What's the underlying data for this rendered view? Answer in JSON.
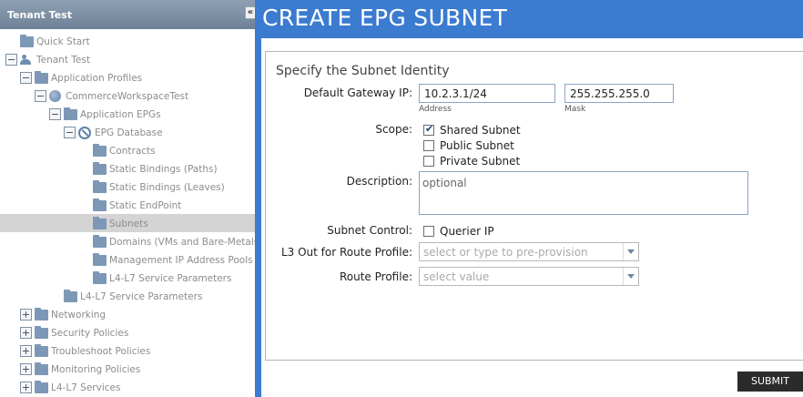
{
  "tree": {
    "title": "Tenant Test",
    "collapse_glyph": "«",
    "nodes": [
      {
        "label": "Quick Start",
        "expander": "none",
        "icon": "folder-icon",
        "indent": 0
      },
      {
        "label": "Tenant Test",
        "expander": "minus",
        "icon": "people-icon",
        "indent": 0
      },
      {
        "label": "Application Profiles",
        "expander": "minus",
        "icon": "folder-icon",
        "indent": 1
      },
      {
        "label": "CommerceWorkspaceTest",
        "expander": "minus",
        "icon": "profile-icon",
        "indent": 2
      },
      {
        "label": "Application EPGs",
        "expander": "minus",
        "icon": "folder-icon",
        "indent": 3
      },
      {
        "label": "EPG Database",
        "expander": "minus",
        "icon": "epg-icon",
        "indent": 4
      },
      {
        "label": "Contracts",
        "expander": "none",
        "icon": "folder-icon",
        "indent": 5
      },
      {
        "label": "Static Bindings (Paths)",
        "expander": "none",
        "icon": "folder-icon",
        "indent": 5
      },
      {
        "label": "Static Bindings (Leaves)",
        "expander": "none",
        "icon": "folder-icon",
        "indent": 5
      },
      {
        "label": "Static EndPoint",
        "expander": "none",
        "icon": "folder-icon",
        "indent": 5
      },
      {
        "label": "Subnets",
        "expander": "none",
        "icon": "folder-icon",
        "indent": 5,
        "selected": true
      },
      {
        "label": "Domains (VMs and Bare-Metals)",
        "expander": "none",
        "icon": "folder-icon",
        "indent": 5
      },
      {
        "label": "Management IP Address Pools",
        "expander": "none",
        "icon": "folder-icon",
        "indent": 5
      },
      {
        "label": "L4-L7 Service Parameters",
        "expander": "none",
        "icon": "folder-icon",
        "indent": 5
      },
      {
        "label": "L4-L7 Service Parameters",
        "expander": "none",
        "icon": "folder-icon",
        "indent": 3
      },
      {
        "label": "Networking",
        "expander": "plus",
        "icon": "folder-icon",
        "indent": 1
      },
      {
        "label": "Security Policies",
        "expander": "plus",
        "icon": "folder-icon",
        "indent": 1
      },
      {
        "label": "Troubleshoot Policies",
        "expander": "plus",
        "icon": "folder-icon",
        "indent": 1
      },
      {
        "label": "Monitoring Policies",
        "expander": "plus",
        "icon": "folder-icon",
        "indent": 1
      },
      {
        "label": "L4-L7 Services",
        "expander": "plus",
        "icon": "folder-icon",
        "indent": 1
      }
    ]
  },
  "dialog": {
    "title": "CREATE EPG SUBNET",
    "section_title": "Specify the Subnet Identity",
    "gateway": {
      "label": "Default Gateway IP:",
      "address_value": "10.2.3.1/24",
      "address_hint": "Address",
      "mask_value": "255.255.255.0",
      "mask_hint": "Mask"
    },
    "scope": {
      "label": "Scope:",
      "options": [
        {
          "label": "Shared Subnet",
          "checked": true
        },
        {
          "label": "Public Subnet",
          "checked": false
        },
        {
          "label": "Private Subnet",
          "checked": false
        }
      ]
    },
    "description": {
      "label": "Description:",
      "placeholder": "optional"
    },
    "subnet_control": {
      "label": "Subnet Control:",
      "option": "Querier IP",
      "checked": false
    },
    "l3out": {
      "label": "L3 Out for Route Profile:",
      "placeholder": "select or type to pre-provision"
    },
    "route_profile": {
      "label": "Route Profile:",
      "placeholder": "select value"
    },
    "submit_label": "SUBMIT"
  }
}
